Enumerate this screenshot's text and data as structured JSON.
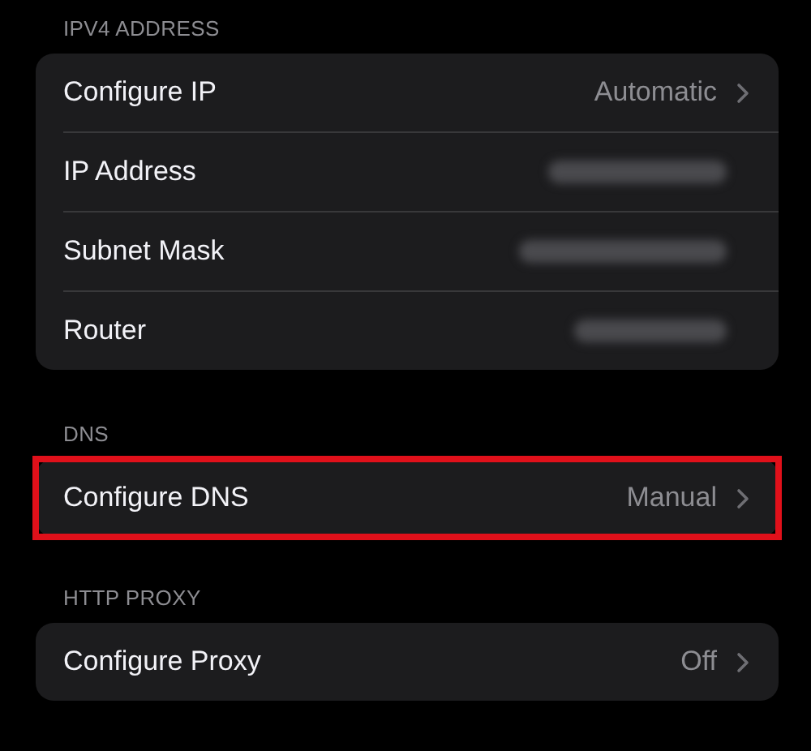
{
  "sections": [
    {
      "header": "IPV4 ADDRESS",
      "rows": [
        {
          "kind": "link",
          "label": "Configure IP",
          "value": "Automatic",
          "highlighted": false
        },
        {
          "kind": "redacted",
          "label": "IP Address",
          "highlighted": false
        },
        {
          "kind": "redacted",
          "label": "Subnet Mask",
          "highlighted": false
        },
        {
          "kind": "redacted",
          "label": "Router",
          "highlighted": false
        }
      ]
    },
    {
      "header": "DNS",
      "rows": [
        {
          "kind": "link",
          "label": "Configure DNS",
          "value": "Manual",
          "highlighted": true
        }
      ]
    },
    {
      "header": "HTTP PROXY",
      "rows": [
        {
          "kind": "link",
          "label": "Configure Proxy",
          "value": "Off",
          "highlighted": false
        }
      ]
    }
  ]
}
